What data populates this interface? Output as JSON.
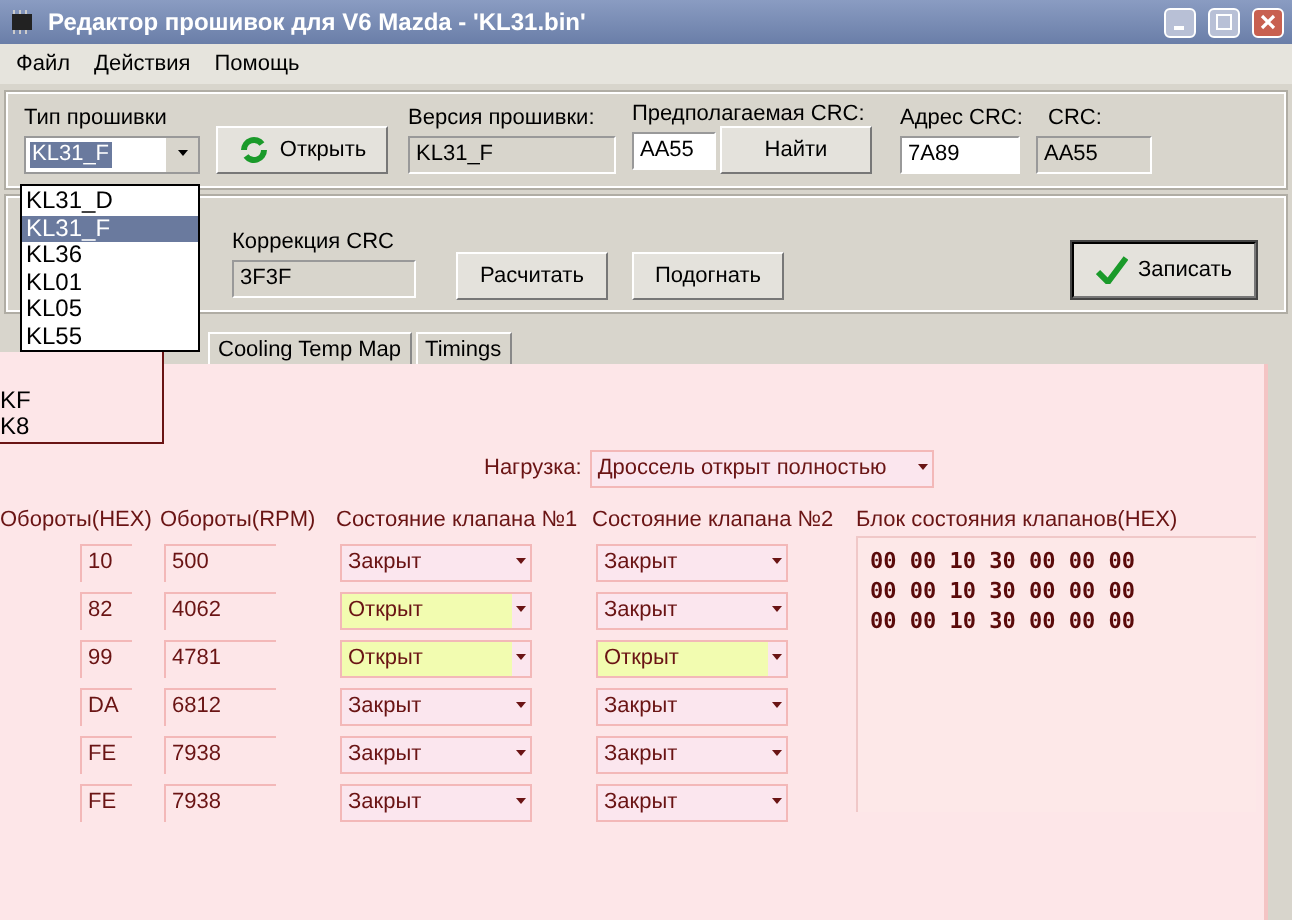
{
  "window": {
    "title": "Редактор прошивок для V6 Mazda - 'KL31.bin'"
  },
  "menu": [
    "Файл",
    "Действия",
    "Помощь"
  ],
  "firmware": {
    "type_label": "Тип прошивки",
    "type_value": "KL31_F",
    "open_button": "Открыть",
    "version_label": "Версия прошивки:",
    "version_value": "KL31_F",
    "expected_crc_label": "Предполагаемая CRC:",
    "expected_crc_value": "AA55",
    "find_button": "Найти",
    "crc_address_label": "Адрес CRC:",
    "crc_address_value": "7A89",
    "crc_label": "CRC:",
    "crc_value": "AA55"
  },
  "correction": {
    "label": "Коррекция CRC",
    "value": "3F3F",
    "calc_button": "Расчитать",
    "fit_button": "Подогнать",
    "write_button": "Записать"
  },
  "dropdown": {
    "items": [
      {
        "label": "KL31_D",
        "selected": false
      },
      {
        "label": "KL31_F",
        "selected": true
      },
      {
        "label": "KL36",
        "selected": false
      },
      {
        "label": "KL01",
        "selected": false
      },
      {
        "label": "KL05",
        "selected": false
      },
      {
        "label": "KL55",
        "selected": false
      }
    ]
  },
  "dropdown_echo": [
    "KF",
    "K8"
  ],
  "tabs": [
    {
      "label": "Cooling Temp Map",
      "selected": false
    },
    {
      "label": "Timings",
      "selected": false
    }
  ],
  "load": {
    "label": "Нагрузка:",
    "value": "Дроссель открыт полностью"
  },
  "table": {
    "columns": [
      "Обороты(HEX)",
      "Обороты(RPM)",
      "Состояние клапана №1",
      "Состояние клапана №2",
      "Блок состояния клапанов(HEX)"
    ],
    "rows": [
      {
        "hex": "10",
        "rpm": "500",
        "valve_1": {
          "value": "Закрыт",
          "highlighted": false
        },
        "valve_2": {
          "value": "Закрыт",
          "highlighted": false
        }
      },
      {
        "hex": "82",
        "rpm": "4062",
        "valve_1": {
          "value": "Открыт",
          "highlighted": true
        },
        "valve_2": {
          "value": "Закрыт",
          "highlighted": false
        }
      },
      {
        "hex": "99",
        "rpm": "4781",
        "valve_1": {
          "value": "Открыт",
          "highlighted": true
        },
        "valve_2": {
          "value": "Открыт",
          "highlighted": true
        }
      },
      {
        "hex": "DA",
        "rpm": "6812",
        "valve_1": {
          "value": "Закрыт",
          "highlighted": false
        },
        "valve_2": {
          "value": "Закрыт",
          "highlighted": false
        }
      },
      {
        "hex": "FE",
        "rpm": "7938",
        "valve_1": {
          "value": "Закрыт",
          "highlighted": false
        },
        "valve_2": {
          "value": "Закрыт",
          "highlighted": false
        }
      },
      {
        "hex": "FE",
        "rpm": "7938",
        "valve_1": {
          "value": "Закрыт",
          "highlighted": false
        },
        "valve_2": {
          "value": "Закрыт",
          "highlighted": false
        }
      }
    ]
  },
  "hex_block": {
    "lines": [
      "00 00 10 30 00 00 00",
      "00 00 10 30 00 00 00",
      "00 00 10 30 00 00 00"
    ]
  }
}
